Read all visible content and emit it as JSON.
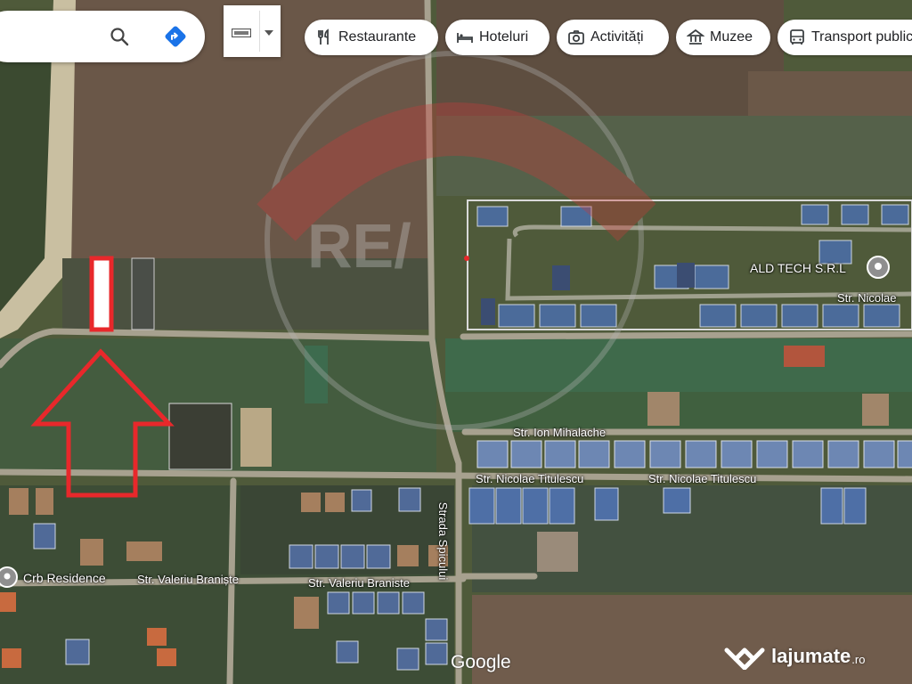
{
  "search": {
    "placeholder": ""
  },
  "chips": [
    {
      "label": "Restaurante",
      "icon": "fork-knife-icon"
    },
    {
      "label": "Hoteluri",
      "icon": "bed-icon"
    },
    {
      "label": "Activități",
      "icon": "camera-icon"
    },
    {
      "label": "Muzee",
      "icon": "museum-icon"
    },
    {
      "label": "Transport public",
      "icon": "bus-icon"
    }
  ],
  "labels": {
    "ald_tech": "ALD TECH S.R.L",
    "str_nicolae_top": "Str. Nicolae",
    "ion_mihalache": "Str. Ion Mihalache",
    "nicolae_titulescu_1": "Str. Nicolae Titulescu",
    "nicolae_titulescu_2": "Str. Nicolae Titulescu",
    "crb_residence": "Crb Residence",
    "valeriu_braniste_1": "Str. Valeriu Braniște",
    "valeriu_braniste_2": "Str. Valeriu Braniste",
    "strada_spicului": "Strada Spicului"
  },
  "branding": {
    "google": "Google",
    "lajumate": "lajumate",
    "lajumate_tld": ".ro"
  },
  "colors": {
    "marker_red": "#e8282b",
    "field_brown": "#6a5646",
    "field_green": "#3f5a3c",
    "road": "#a7a18f"
  }
}
